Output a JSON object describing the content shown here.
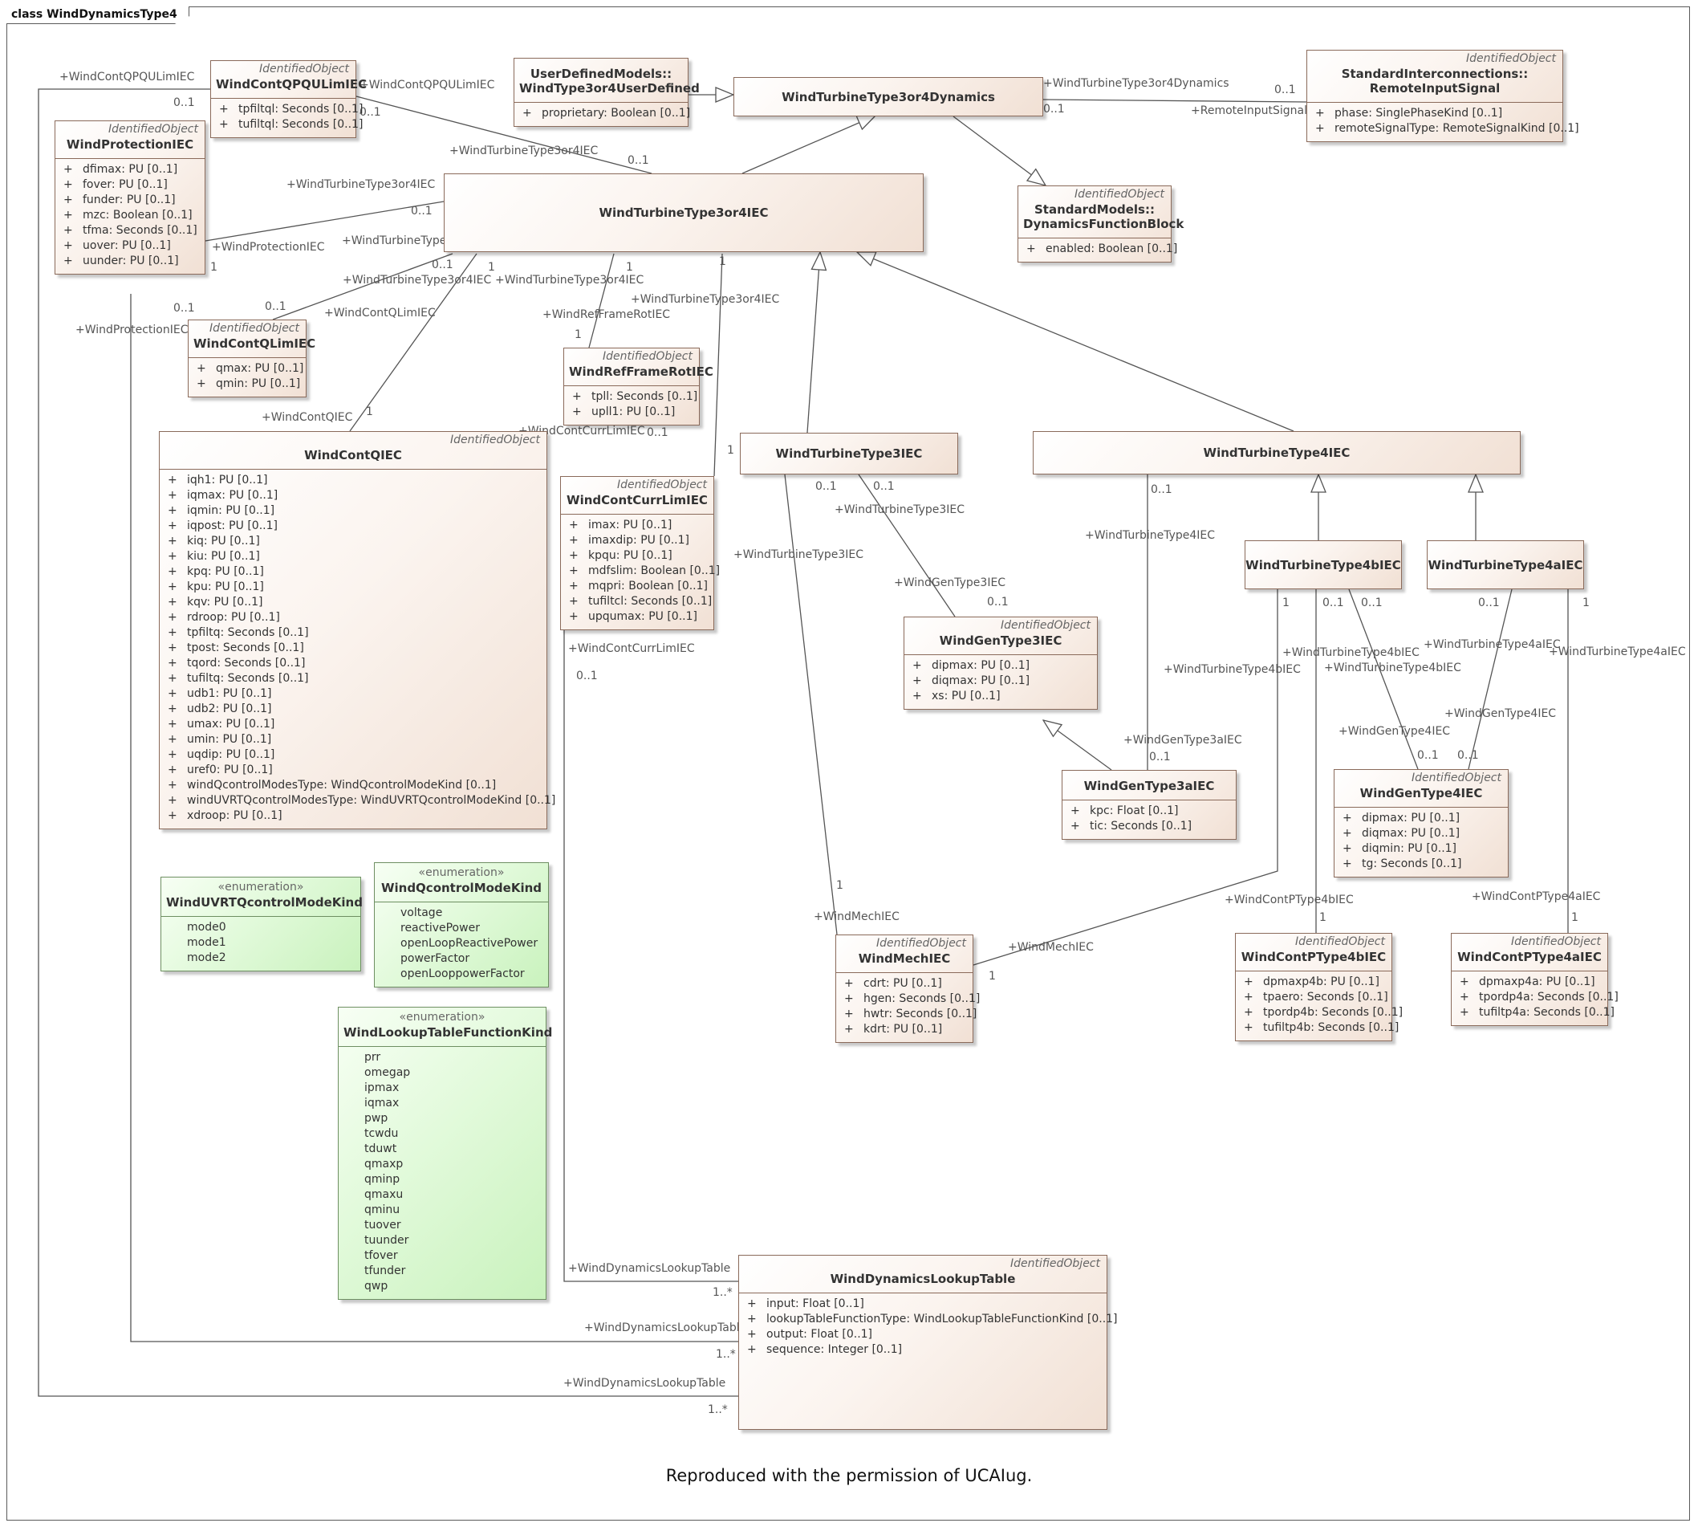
{
  "frame_title": "class WindDynamicsType4",
  "caption": "Reproduced with the permission of UCAIug.",
  "classes": {
    "windContQPQULimIEC": {
      "stereotype": "IdentifiedObject",
      "name": "WindContQPQULimIEC",
      "attrs": [
        "tpfiltql: Seconds [0..1]",
        "tufiltql: Seconds [0..1]"
      ]
    },
    "windProtectionIEC": {
      "stereotype": "IdentifiedObject",
      "name": "WindProtectionIEC",
      "attrs": [
        "dfimax: PU [0..1]",
        "fover: PU [0..1]",
        "funder: PU [0..1]",
        "mzc: Boolean [0..1]",
        "tfma: Seconds [0..1]",
        "uover: PU [0..1]",
        "uunder: PU [0..1]"
      ]
    },
    "windType3or4UserDefined": {
      "stereotype": "",
      "name": "UserDefinedModels::\nWindType3or4UserDefined",
      "attrs": [
        "proprietary: Boolean [0..1]"
      ]
    },
    "windTurbineType3or4Dynamics": {
      "stereotype": "",
      "name": "WindTurbineType3or4Dynamics",
      "attrs": []
    },
    "remoteInputSignal": {
      "stereotype": "IdentifiedObject",
      "name": "StandardInterconnections::\nRemoteInputSignal",
      "attrs": [
        "phase: SinglePhaseKind [0..1]",
        "remoteSignalType: RemoteSignalKind [0..1]"
      ]
    },
    "windTurbineType3or4IEC": {
      "stereotype": "",
      "name": "WindTurbineType3or4IEC",
      "attrs": []
    },
    "dynamicsFunctionBlock": {
      "stereotype": "IdentifiedObject",
      "name": "StandardModels::\nDynamicsFunctionBlock",
      "attrs": [
        "enabled: Boolean [0..1]"
      ]
    },
    "windContQLimIEC": {
      "stereotype": "IdentifiedObject",
      "name": "WindContQLimIEC",
      "attrs": [
        "qmax: PU [0..1]",
        "qmin: PU [0..1]"
      ]
    },
    "windRefFrameRotIEC": {
      "stereotype": "IdentifiedObject",
      "name": "WindRefFrameRotIEC",
      "attrs": [
        "tpll: Seconds [0..1]",
        "upll1: PU [0..1]"
      ]
    },
    "windContQIEC": {
      "stereotype": "IdentifiedObject",
      "name": "WindContQIEC",
      "attrs": [
        "iqh1: PU [0..1]",
        "iqmax: PU [0..1]",
        "iqmin: PU [0..1]",
        "iqpost: PU [0..1]",
        "kiq: PU [0..1]",
        "kiu: PU [0..1]",
        "kpq: PU [0..1]",
        "kpu: PU [0..1]",
        "kqv: PU [0..1]",
        "rdroop: PU [0..1]",
        "tpfiltq: Seconds [0..1]",
        "tpost: Seconds [0..1]",
        "tqord: Seconds [0..1]",
        "tufiltq: Seconds [0..1]",
        "udb1: PU [0..1]",
        "udb2: PU [0..1]",
        "umax: PU [0..1]",
        "umin: PU [0..1]",
        "uqdip: PU [0..1]",
        "uref0: PU [0..1]",
        "windQcontrolModesType: WindQcontrolModeKind [0..1]",
        "windUVRTQcontrolModesType: WindUVRTQcontrolModeKind [0..1]",
        "xdroop: PU [0..1]"
      ]
    },
    "windContCurrLimIEC": {
      "stereotype": "IdentifiedObject",
      "name": "WindContCurrLimIEC",
      "attrs": [
        "imax: PU [0..1]",
        "imaxdip: PU [0..1]",
        "kpqu: PU [0..1]",
        "mdfslim: Boolean [0..1]",
        "mqpri: Boolean [0..1]",
        "tufiltcl: Seconds [0..1]",
        "upqumax: PU [0..1]"
      ]
    },
    "windTurbineType3IEC": {
      "stereotype": "",
      "name": "WindTurbineType3IEC",
      "attrs": []
    },
    "windTurbineType4IEC": {
      "stereotype": "",
      "name": "WindTurbineType4IEC",
      "attrs": []
    },
    "windTurbineType4bIEC": {
      "stereotype": "",
      "name": "WindTurbineType4bIEC",
      "attrs": []
    },
    "windTurbineType4aIEC": {
      "stereotype": "",
      "name": "WindTurbineType4aIEC",
      "attrs": []
    },
    "windGenType3IEC": {
      "stereotype": "IdentifiedObject",
      "name": "WindGenType3IEC",
      "attrs": [
        "dipmax: PU [0..1]",
        "diqmax: PU [0..1]",
        "xs: PU [0..1]"
      ]
    },
    "windGenType3aIEC": {
      "stereotype": "",
      "name": "WindGenType3aIEC",
      "attrs": [
        "kpc: Float [0..1]",
        "tic: Seconds [0..1]"
      ]
    },
    "windGenType4IEC": {
      "stereotype": "IdentifiedObject",
      "name": "WindGenType4IEC",
      "attrs": [
        "dipmax: PU [0..1]",
        "diqmax: PU [0..1]",
        "diqmin: PU [0..1]",
        "tg: Seconds [0..1]"
      ]
    },
    "windMechIEC": {
      "stereotype": "IdentifiedObject",
      "name": "WindMechIEC",
      "attrs": [
        "cdrt: PU [0..1]",
        "hgen: Seconds [0..1]",
        "hwtr: Seconds [0..1]",
        "kdrt: PU [0..1]"
      ]
    },
    "windContPType4bIEC": {
      "stereotype": "IdentifiedObject",
      "name": "WindContPType4bIEC",
      "attrs": [
        "dpmaxp4b: PU [0..1]",
        "tpaero: Seconds [0..1]",
        "tpordp4b: Seconds [0..1]",
        "tufiltp4b: Seconds [0..1]"
      ]
    },
    "windContPType4aIEC": {
      "stereotype": "IdentifiedObject",
      "name": "WindContPType4aIEC",
      "attrs": [
        "dpmaxp4a: PU [0..1]",
        "tpordp4a: Seconds [0..1]",
        "tufiltp4a: Seconds [0..1]"
      ]
    },
    "windDynamicsLookupTable": {
      "stereotype": "IdentifiedObject",
      "name": "WindDynamicsLookupTable",
      "attrs": [
        "input: Float [0..1]",
        "lookupTableFunctionType: WindLookupTableFunctionKind [0..1]",
        "output: Float [0..1]",
        "sequence: Integer [0..1]"
      ]
    }
  },
  "enums": {
    "windUVRTQcontrolModeKind": {
      "stereotype": "«enumeration»",
      "name": "WindUVRTQcontrolModeKind",
      "literals": [
        "mode0",
        "mode1",
        "mode2"
      ]
    },
    "windQcontrolModeKind": {
      "stereotype": "«enumeration»",
      "name": "WindQcontrolModeKind",
      "literals": [
        "voltage",
        "reactivePower",
        "openLoopReactivePower",
        "powerFactor",
        "openLooppowerFactor"
      ]
    },
    "windLookupTableFunctionKind": {
      "stereotype": "«enumeration»",
      "name": "WindLookupTableFunctionKind",
      "literals": [
        "prr",
        "omegap",
        "ipmax",
        "iqmax",
        "pwp",
        "tcwdu",
        "tduwt",
        "qmaxp",
        "qminp",
        "qmaxu",
        "qminu",
        "tuover",
        "tuunder",
        "tfover",
        "tfunder",
        "qwp"
      ]
    }
  },
  "role_labels": [
    "+WindContQPQULimIEC",
    "0..1",
    "+WindContQPQULimIEC",
    "0..1",
    "+WindTurbineType3or4IEC",
    "0..1",
    "+WindTurbineType3or4Dynamics",
    "0..1",
    "0..1",
    "+RemoteInputSignal",
    "+WindTurbineType3or4IEC",
    "0..1",
    "+WindProtectionIEC",
    "1",
    "+WindTurbineType3or4IEC",
    "0..1",
    "1",
    "+WindTurbineType3or4IEC",
    "+WindTurbineType3or4IEC",
    "1",
    "+WindTurbineType3or4IEC",
    "1",
    "+WindContQLimIEC",
    "0..1",
    "+WindRefFrameRotIEC",
    "1",
    "+WindProtectionIEC",
    "0..1",
    "+WindContQIEC",
    "1",
    "+WindContCurrLimIEC",
    "0..1",
    "+WindContCurrLimIEC",
    "0..1",
    "1",
    "0..1",
    "0..1",
    "+WindTurbineType3IEC",
    "+WindTurbineType3IEC",
    "+WindGenType3IEC",
    "0..1",
    "0..1",
    "+WindTurbineType4IEC",
    "0..1",
    "1",
    "0..1",
    "0..1",
    "1",
    "+WindTurbineType4bIEC",
    "+WindTurbineType4bIEC",
    "+WindTurbineType4aIEC",
    "+WindTurbineType4aIEC",
    "+WindTurbineType4bIEC",
    "+WindGenType4IEC",
    "+WindGenType4IEC",
    "0..1",
    "0..1",
    "+WindGenType3aIEC",
    "0..1",
    "1",
    "+WindMechIEC",
    "+WindMechIEC",
    "1",
    "+WindContPType4bIEC",
    "1",
    "+WindContPType4aIEC",
    "1",
    "+WindDynamicsLookupTable",
    "1..*",
    "+WindDynamicsLookupTable",
    "1..*",
    "+WindDynamicsLookupTable",
    "1..*"
  ]
}
